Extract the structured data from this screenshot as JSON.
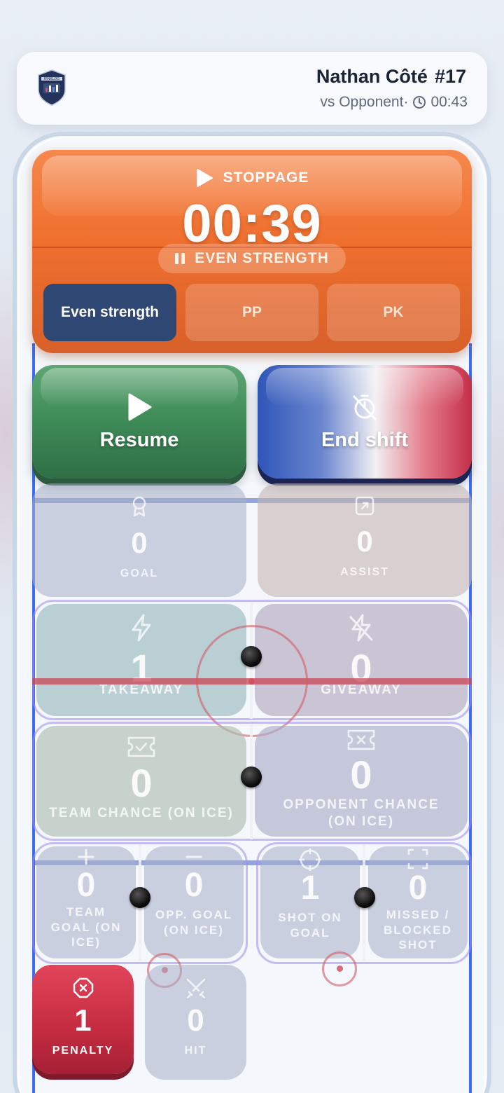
{
  "header": {
    "logo_text": "RINKLOG",
    "player_name": "Nathan Côté",
    "player_number": "#17",
    "opponent": "vs Opponent·",
    "elapsed": "00:43"
  },
  "status": {
    "state_label": "STOPPAGE",
    "timer": "00:39",
    "strength_chip": "EVEN STRENGTH",
    "segments": [
      {
        "label": "Even strength",
        "active": true
      },
      {
        "label": "PP",
        "active": false
      },
      {
        "label": "PK",
        "active": false
      }
    ]
  },
  "actions": {
    "resume_label": "Resume",
    "end_shift_label": "End shift"
  },
  "stats": {
    "goal": {
      "value": "0",
      "label": "GOAL"
    },
    "assist": {
      "value": "0",
      "label": "ASSIST"
    },
    "takeaway": {
      "value": "1",
      "label": "TAKEAWAY"
    },
    "giveaway": {
      "value": "0",
      "label": "GIVEAWAY"
    },
    "team_chance": {
      "value": "0",
      "label": "TEAM CHANCE (ON ICE)"
    },
    "opp_chance": {
      "value": "0",
      "label_1": "OPPONENT CHANCE",
      "label_2": "(ON ICE)"
    },
    "team_goal": {
      "value": "0",
      "label_1": "TEAM",
      "label_2": "GOAL (ON",
      "label_3": "ICE)"
    },
    "opp_goal": {
      "value": "0",
      "label_1": "OPP. GOAL",
      "label_2": "(ON ICE)"
    },
    "shot_on_goal": {
      "value": "1",
      "label_1": "SHOT ON",
      "label_2": "GOAL"
    },
    "missed_shot": {
      "value": "0",
      "label_1": "MISSED /",
      "label_2": "BLOCKED",
      "label_3": "SHOT"
    },
    "penalty": {
      "value": "1",
      "label": "PENALTY"
    },
    "hit": {
      "value": "0",
      "label": "HIT"
    }
  },
  "colors": {
    "stoppage": "#ef6f2e",
    "active_segment": "#2f4873",
    "resume": "#3d8a57",
    "penalty": "#c42b40"
  }
}
